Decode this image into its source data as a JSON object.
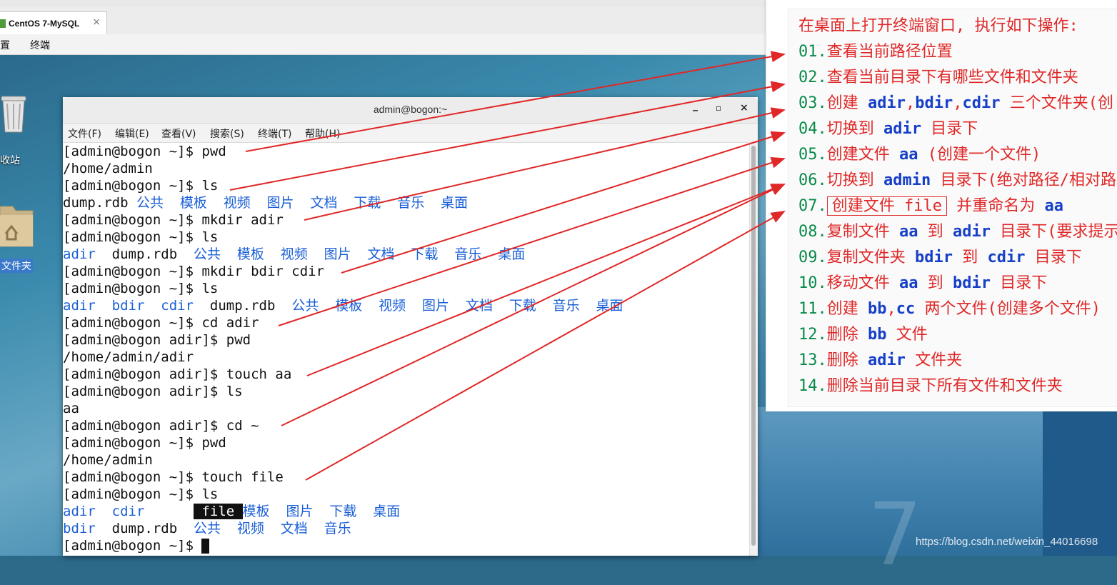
{
  "vm": {
    "tab_title": "CentOS 7-MySQL",
    "tab_close": "×",
    "menu": [
      "置",
      "终端"
    ]
  },
  "desktop": {
    "trash_label": "收站",
    "home_label": "文件夹",
    "watermark": "https://blog.csdn.net/weixin_44016698",
    "brand_numeral": "7"
  },
  "terminal": {
    "title": "admin@bogon:~",
    "buttons": [
      "_",
      "▫",
      "×"
    ],
    "menu": [
      "文件(F)",
      "编辑(E)",
      "查看(V)",
      "搜索(S)",
      "终端(T)",
      "帮助(H)"
    ],
    "lines": [
      [
        {
          "t": "[admin@bogon ~]$ pwd"
        }
      ],
      [
        {
          "t": "/home/admin"
        }
      ],
      [
        {
          "t": "[admin@bogon ~]$ ls"
        }
      ],
      [
        {
          "t": "dump.rdb "
        },
        {
          "t": "公共  模板  视频  图片  文档  下载  音乐  桌面",
          "c": "b"
        }
      ],
      [
        {
          "t": "[admin@bogon ~]$ mkdir adir"
        }
      ],
      [
        {
          "t": "[admin@bogon ~]$ ls"
        }
      ],
      [
        {
          "t": "adir",
          "c": "b"
        },
        {
          "t": "  dump.rdb  "
        },
        {
          "t": "公共  模板  视频  图片  文档  下载  音乐  桌面",
          "c": "b"
        }
      ],
      [
        {
          "t": "[admin@bogon ~]$ mkdir bdir cdir"
        }
      ],
      [
        {
          "t": "[admin@bogon ~]$ ls"
        }
      ],
      [
        {
          "t": "adir  bdir  cdir",
          "c": "b"
        },
        {
          "t": "  dump.rdb  "
        },
        {
          "t": "公共  模板  视频  图片  文档  下载  音乐  桌面",
          "c": "b"
        }
      ],
      [
        {
          "t": "[admin@bogon ~]$ cd adir"
        }
      ],
      [
        {
          "t": "[admin@bogon adir]$ pwd"
        }
      ],
      [
        {
          "t": "/home/admin/adir"
        }
      ],
      [
        {
          "t": "[admin@bogon adir]$ touch aa"
        }
      ],
      [
        {
          "t": "[admin@bogon adir]$ ls"
        }
      ],
      [
        {
          "t": "aa"
        }
      ],
      [
        {
          "t": "[admin@bogon adir]$ cd ~"
        }
      ],
      [
        {
          "t": "[admin@bogon ~]$ pwd"
        }
      ],
      [
        {
          "t": "/home/admin"
        }
      ],
      [
        {
          "t": "[admin@bogon ~]$ touch file"
        }
      ],
      [
        {
          "t": "[admin@bogon ~]$ ls"
        }
      ],
      [
        {
          "t": "adir  cdir",
          "c": "b"
        },
        {
          "t": "      "
        },
        {
          "t": " file ",
          "c": "hl"
        },
        {
          "t": "模板  图片  下载  桌面",
          "c": "b"
        }
      ],
      [
        {
          "t": "bdir",
          "c": "b"
        },
        {
          "t": "  dump.rdb  "
        },
        {
          "t": "公共  视频  文档  音乐",
          "c": "b"
        }
      ],
      [
        {
          "t": "[admin@bogon ~]$ "
        },
        {
          "t": "",
          "c": "cursor"
        }
      ]
    ]
  },
  "notes": {
    "lines": [
      [
        {
          "t": "在桌面上打开终端窗口, 执行如下操作:"
        }
      ],
      [
        {
          "t": "01.",
          "c": "num"
        },
        {
          "t": "查看当前路径位置"
        }
      ],
      [
        {
          "t": "02.",
          "c": "num"
        },
        {
          "t": "查看当前目录下有哪些文件和文件夹"
        }
      ],
      [
        {
          "t": "03.",
          "c": "num"
        },
        {
          "t": "创建 "
        },
        {
          "t": "adir",
          "c": "cmd"
        },
        {
          "t": ","
        },
        {
          "t": "bdir",
          "c": "cmd"
        },
        {
          "t": ","
        },
        {
          "t": "cdir",
          "c": "cmd"
        },
        {
          "t": " 三个文件夹(创"
        }
      ],
      [
        {
          "t": "04.",
          "c": "num"
        },
        {
          "t": "切换到 "
        },
        {
          "t": "adir",
          "c": "cmd"
        },
        {
          "t": " 目录下"
        }
      ],
      [
        {
          "t": "05.",
          "c": "num"
        },
        {
          "t": "创建文件 "
        },
        {
          "t": "aa",
          "c": "cmd"
        },
        {
          "t": " (创建一个文件)"
        }
      ],
      [
        {
          "t": "06.",
          "c": "num"
        },
        {
          "t": "切换到 "
        },
        {
          "t": "admin",
          "c": "cmd"
        },
        {
          "t": " 目录下(绝对路径/相对路"
        }
      ],
      [
        {
          "t": "07.",
          "c": "num"
        },
        {
          "t": "创建文件 file",
          "c": "boxed"
        },
        {
          "t": " 并重命名为 "
        },
        {
          "t": "aa",
          "c": "cmd"
        }
      ],
      [
        {
          "t": "08.",
          "c": "num"
        },
        {
          "t": "复制文件 "
        },
        {
          "t": "aa",
          "c": "cmd"
        },
        {
          "t": " 到 "
        },
        {
          "t": "adir",
          "c": "cmd"
        },
        {
          "t": " 目录下(要求提示"
        }
      ],
      [
        {
          "t": "09.",
          "c": "num"
        },
        {
          "t": "复制文件夹 "
        },
        {
          "t": "bdir",
          "c": "cmd"
        },
        {
          "t": " 到 "
        },
        {
          "t": "cdir",
          "c": "cmd"
        },
        {
          "t": " 目录下"
        }
      ],
      [
        {
          "t": "10.",
          "c": "num"
        },
        {
          "t": "移动文件 "
        },
        {
          "t": "aa",
          "c": "cmd"
        },
        {
          "t": " 到 "
        },
        {
          "t": "bdir",
          "c": "cmd"
        },
        {
          "t": " 目录下"
        }
      ],
      [
        {
          "t": "11.",
          "c": "num"
        },
        {
          "t": "创建 "
        },
        {
          "t": "bb",
          "c": "cmd"
        },
        {
          "t": ","
        },
        {
          "t": "cc",
          "c": "cmd"
        },
        {
          "t": " 两个文件(创建多个文件)"
        }
      ],
      [
        {
          "t": "12.",
          "c": "num"
        },
        {
          "t": "删除 "
        },
        {
          "t": "bb",
          "c": "cmd"
        },
        {
          "t": " 文件"
        }
      ],
      [
        {
          "t": "13.",
          "c": "num"
        },
        {
          "t": "删除 "
        },
        {
          "t": "adir",
          "c": "cmd"
        },
        {
          "t": " 文件夹"
        }
      ],
      [
        {
          "t": "14.",
          "c": "num"
        },
        {
          "t": "删除当前目录下所有文件和文件夹"
        }
      ]
    ]
  },
  "colors": {
    "prompt_text": "#111111",
    "dir_blue": "#1a5fd6",
    "note_red": "#e02828",
    "note_green": "#0a8a4a",
    "note_cmd_blue": "#1740c8",
    "arrow_red": "#e02828"
  }
}
